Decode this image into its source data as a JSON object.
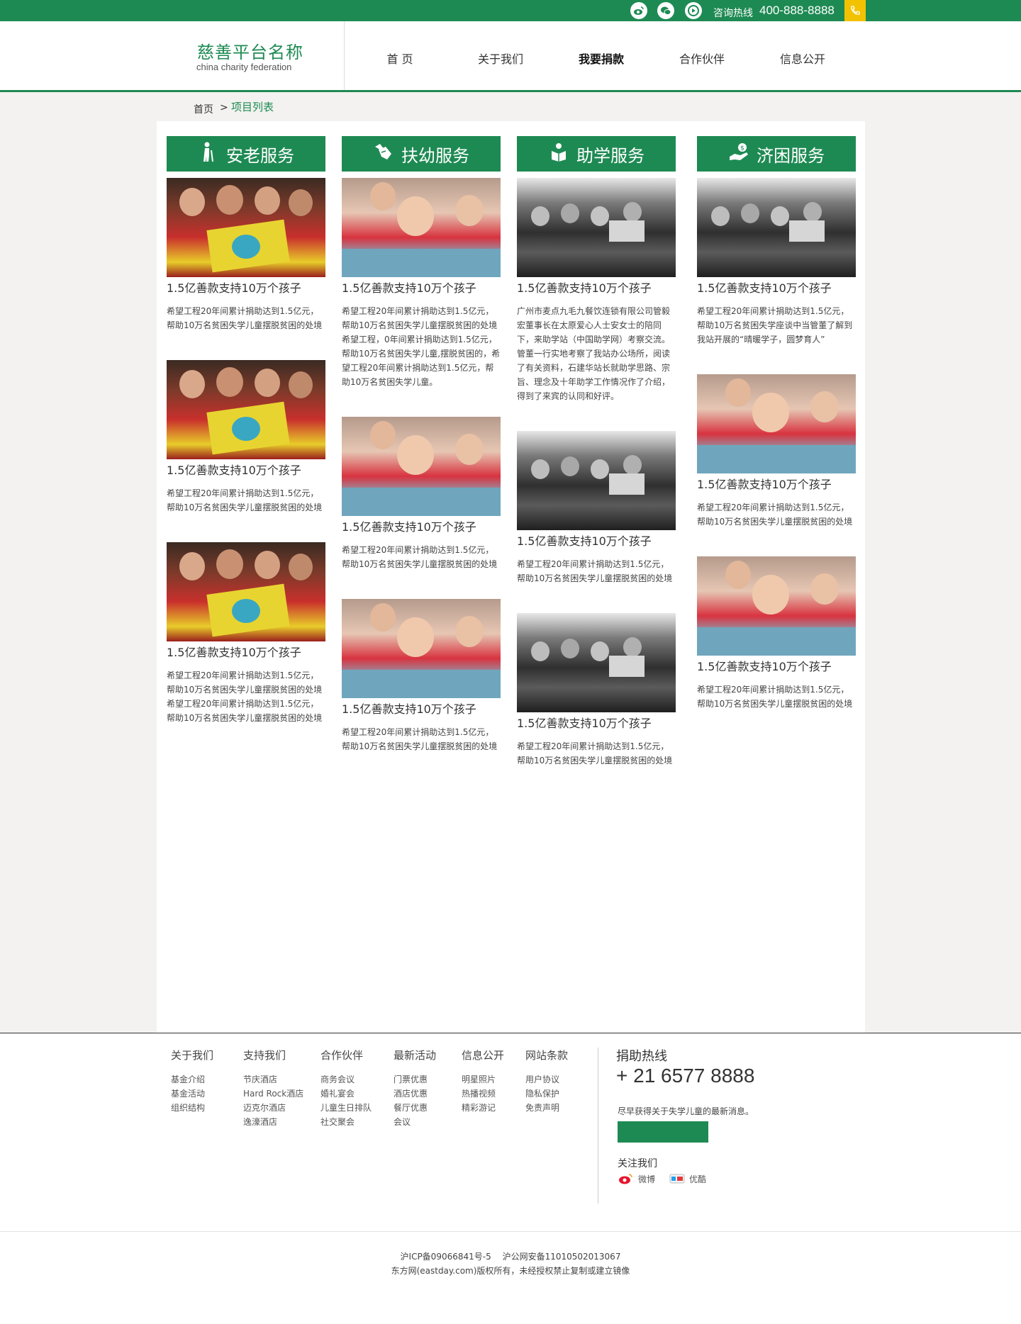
{
  "topbar": {
    "social_icons": [
      "weibo-icon",
      "wechat-icon",
      "video-icon"
    ],
    "hotline_label": "咨询热线",
    "hotline_number": "400-888-8888",
    "phone_icon": "phone-icon",
    "colors": {
      "brand": "#1e8a53",
      "accent": "#f2c200"
    }
  },
  "header": {
    "logo_title": "慈善平台名称",
    "logo_subtitle": "china charity federation",
    "nav": [
      {
        "label": "首 页",
        "active": false
      },
      {
        "label": "关于我们",
        "active": false
      },
      {
        "label": "我要捐款",
        "active": true
      },
      {
        "label": "合作伙伴",
        "active": false
      },
      {
        "label": "信息公开",
        "active": false
      }
    ]
  },
  "breadcrumb": {
    "home": "首页",
    "separator": ">",
    "current": "项目列表"
  },
  "columns": [
    {
      "category": "安老服务",
      "icon": "elderly-person-icon",
      "cards": [
        {
          "image": "children-reading-photo",
          "title": "1.5亿善款支持10万个孩子",
          "desc": "希望工程20年间累计捐助达到1.5亿元，帮助10万名贫困失学儿童摆脱贫困的处境"
        },
        {
          "image": "children-reading-photo",
          "title": "1.5亿善款支持10万个孩子",
          "desc": "希望工程20年间累计捐助达到1.5亿元，帮助10万名贫困失学儿童摆脱贫困的处境"
        },
        {
          "image": "children-reading-photo",
          "title": "1.5亿善款支持10万个孩子",
          "desc": "希望工程20年间累计捐助达到1.5亿元，帮助10万名贫困失学儿童摆脱贫困的处境希望工程20年间累计捐助达到1.5亿元，帮助10万名贫困失学儿童摆脱贫困的处境"
        }
      ]
    },
    {
      "category": "扶幼服务",
      "icon": "helping-hands-icon",
      "cards": [
        {
          "image": "girl-writing-photo",
          "title": "1.5亿善款支持10万个孩子",
          "desc": "希望工程20年间累计捐助达到1.5亿元，帮助10万名贫困失学儿童摆脱贫困的处境希望工程，0年间累计捐助达到1.5亿元，帮助10万名贫困失学儿童,摆脱贫困的，希望工程20年间累计捐助达到1.5亿元，帮助10万名贫困失学儿童。"
        },
        {
          "image": "girl-writing-photo",
          "title": "1.5亿善款支持10万个孩子",
          "desc": "希望工程20年间累计捐助达到1.5亿元，帮助10万名贫困失学儿童摆脱贫困的处境"
        },
        {
          "image": "girl-writing-photo",
          "title": "1.5亿善款支持10万个孩子",
          "desc": "希望工程20年间累计捐助达到1.5亿元，帮助10万名贫困失学儿童摆脱贫困的处境"
        }
      ]
    },
    {
      "category": "助学服务",
      "icon": "student-book-icon",
      "cards": [
        {
          "image": "classroom-bw-photo",
          "title": "1.5亿善款支持10万个孩子",
          "desc": "广州市麦点九毛九餐饮连锁有限公司管毅宏董事长在太原爱心人士安女士的陪同下，来助学站（中国助学网）考察交流。管董一行实地考察了我站办公场所，阅读了有关资料，石建华站长就助学思路、宗旨、理念及十年助学工作情况作了介绍，得到了来宾的认同和好评。"
        },
        {
          "image": "classroom-bw-photo",
          "title": "1.5亿善款支持10万个孩子",
          "desc": "希望工程20年间累计捐助达到1.5亿元，帮助10万名贫困失学儿童摆脱贫困的处境"
        },
        {
          "image": "classroom-bw-photo",
          "title": "1.5亿善款支持10万个孩子",
          "desc": "希望工程20年间累计捐助达到1.5亿元，帮助10万名贫困失学儿童摆脱贫困的处境"
        }
      ]
    },
    {
      "category": "济困服务",
      "icon": "money-hand-icon",
      "cards": [
        {
          "image": "classroom-bw-photo",
          "title": "1.5亿善款支持10万个孩子",
          "desc": "希望工程20年间累计捐助达到1.5亿元，帮助10万名贫困失学座谈中当管董了解到我站开展的“晴暖学子，圆梦育人”"
        },
        {
          "image": "girl-writing-photo",
          "title": "1.5亿善款支持10万个孩子",
          "desc": "希望工程20年间累计捐助达到1.5亿元，帮助10万名贫困失学儿童摆脱贫困的处境"
        },
        {
          "image": "girl-writing-photo",
          "title": "1.5亿善款支持10万个孩子",
          "desc": "希望工程20年间累计捐助达到1.5亿元，帮助10万名贫困失学儿童摆脱贫困的处境"
        }
      ]
    }
  ],
  "footer": {
    "link_columns": [
      {
        "heading": "关于我们",
        "links": [
          "基金介绍",
          "基金活动",
          "组织结构"
        ]
      },
      {
        "heading": "支持我们",
        "links": [
          "节庆酒店",
          "Hard Rock酒店",
          "迈克尔酒店",
          "逸濠酒店"
        ]
      },
      {
        "heading": "合作伙伴",
        "links": [
          "商务会议",
          "婚礼宴会",
          "儿童生日排队",
          "社交聚会"
        ]
      },
      {
        "heading": "最新活动",
        "links": [
          "门票优惠",
          "酒店优惠",
          "餐厅优惠",
          "会议"
        ]
      },
      {
        "heading": "信息公开",
        "links": [
          "明星照片",
          "热播视频",
          "精彩游记"
        ]
      },
      {
        "heading": "网站条款",
        "links": [
          "用户协议",
          "隐私保护",
          "免责声明"
        ]
      }
    ],
    "donate_title": "捐助热线",
    "donate_phone": "+ 21 6577 8888",
    "donate_note": "尽早获得关于失学儿童的最新消息。",
    "follow_title": "关注我们",
    "follow": [
      {
        "icon": "weibo-icon",
        "label": "微博"
      },
      {
        "icon": "youku-icon",
        "label": "优酷"
      }
    ]
  },
  "bottom": {
    "icp": "沪ICP备09066841号-5",
    "police": "沪公网安备11010502013067",
    "copyright": "东方网(eastday.com)版权所有，未经授权禁止复制或建立镜像"
  }
}
